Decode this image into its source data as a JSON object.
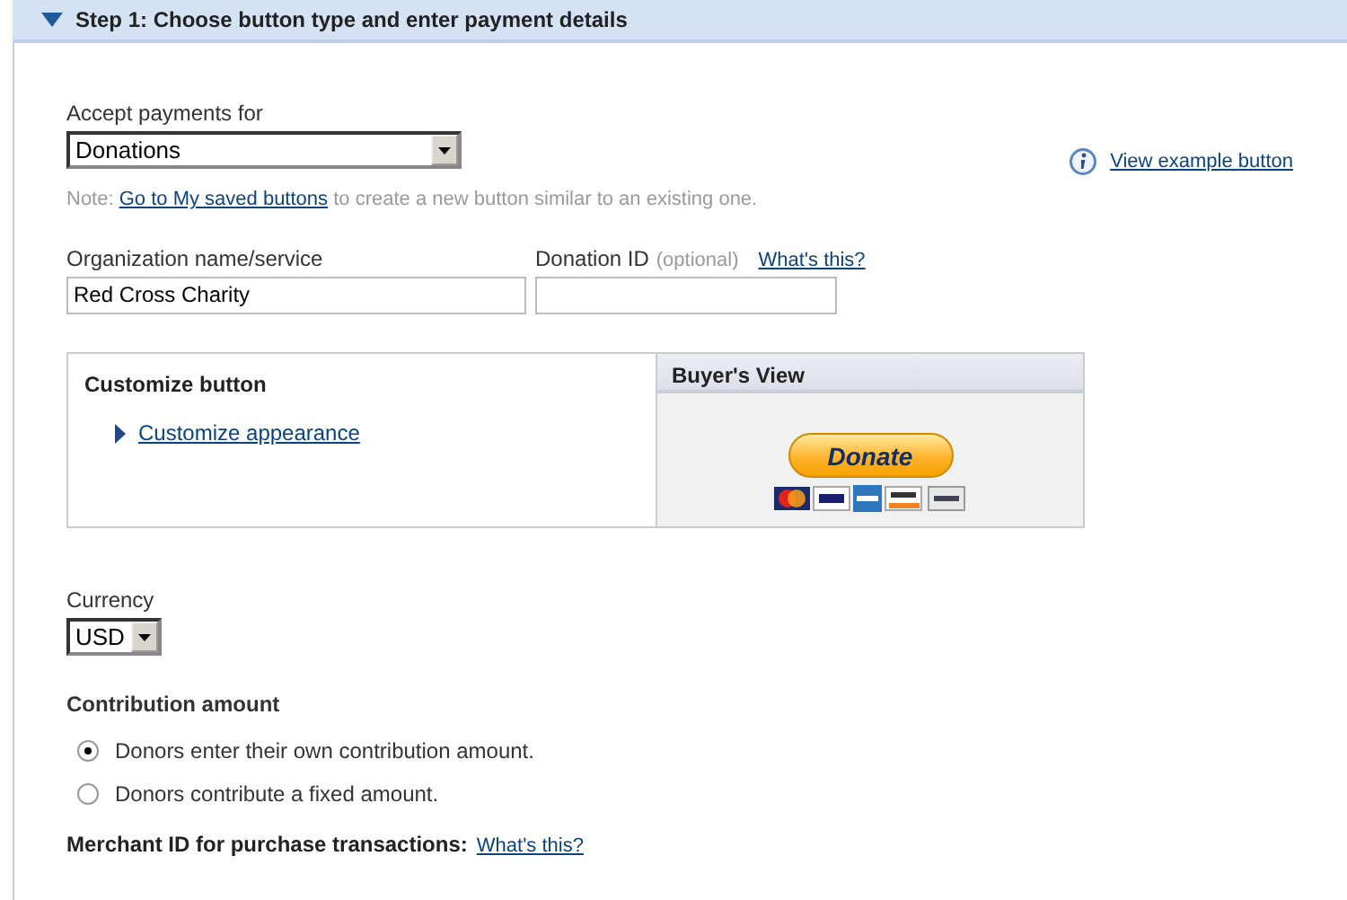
{
  "section": {
    "title": "Step 1: Choose button type and enter payment details",
    "expanded": true
  },
  "payment_type": {
    "label": "Accept payments for",
    "value": "Donations"
  },
  "example_link": "View example button",
  "note": {
    "prefix": "Note:",
    "link": "Go to My saved buttons",
    "suffix": "to create a new button similar to an existing one."
  },
  "organization": {
    "label": "Organization name/service",
    "value": "Red Cross Charity"
  },
  "donation_id": {
    "label": "Donation ID",
    "optional": "(optional)",
    "help": "What's this?"
  },
  "customize": {
    "title": "Customize button",
    "link": "Customize appearance"
  },
  "buyers_view": {
    "title": "Buyer's View",
    "button": "Donate"
  },
  "currency": {
    "label": "Currency",
    "value": "USD"
  },
  "contribution": {
    "title": "Contribution amount",
    "options": [
      {
        "label": "Donors enter their own contribution amount.",
        "selected": true
      },
      {
        "label": "Donors contribute a fixed amount.",
        "selected": false
      }
    ]
  },
  "merchant": {
    "label": "Merchant ID for purchase transactions:",
    "help": "What's this?"
  }
}
